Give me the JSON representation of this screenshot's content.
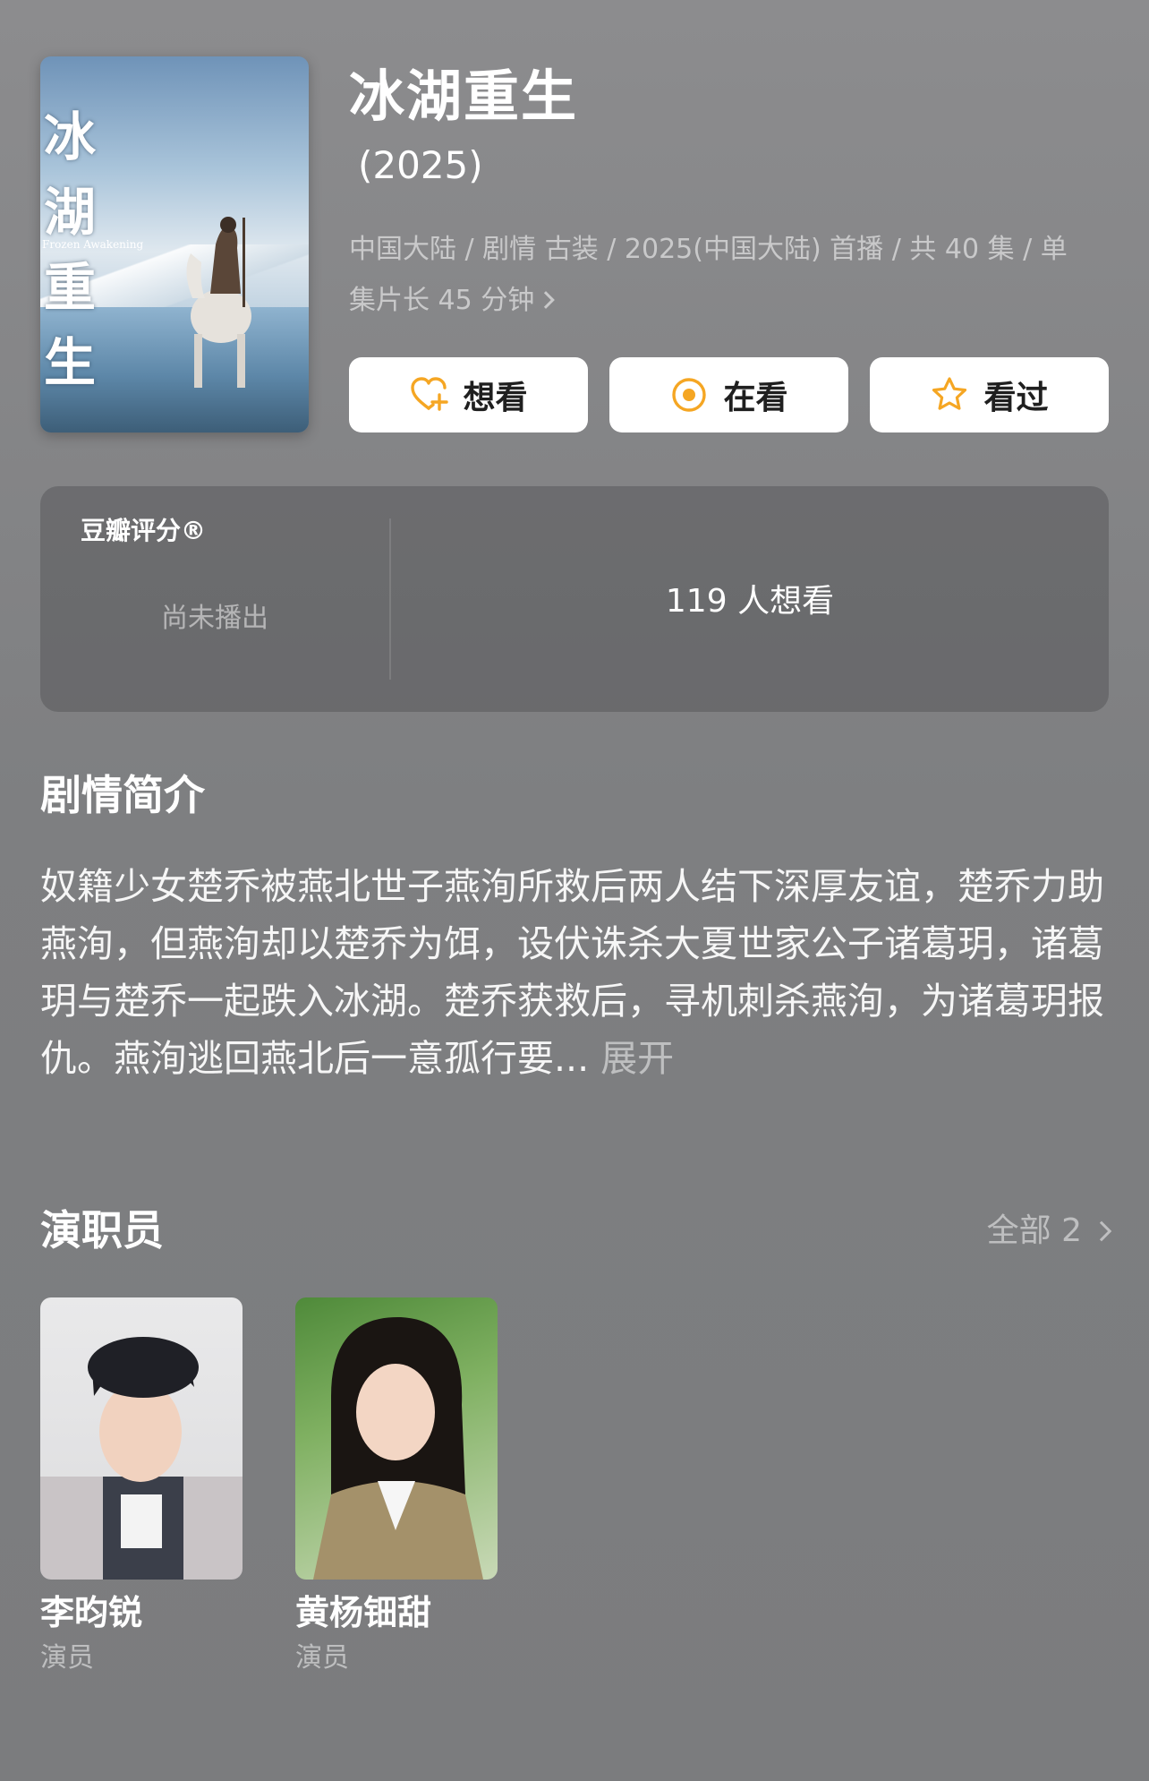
{
  "show": {
    "poster_calligraphy": "冰湖重生",
    "poster_subtitle": "Frozen Awakening",
    "title": "冰湖重生",
    "year": "(2025)",
    "meta_line1": "中国大陆 / 剧情 古装 / 2025(中国大陆) 首播 / 共 40 集 / 单",
    "meta_line2": "集片长 45 分钟"
  },
  "actions": {
    "want": "想看",
    "doing": "在看",
    "done": "看过"
  },
  "rating": {
    "label": "豆瓣评分®",
    "status": "尚未播出",
    "wish_count": "119 人想看"
  },
  "synopsis": {
    "heading": "剧情简介",
    "text": "奴籍少女楚乔被燕北世子燕洵所救后两人结下深厚友谊，楚乔力助燕洵，但燕洵却以楚乔为饵，设伏诛杀大夏世家公子诸葛玥，诸葛玥与楚乔一起跌入冰湖。楚乔获救后，寻机刺杀燕洵，为诸葛玥报仇。燕洵逃回燕北后一意孤行要...",
    "expand": "展开"
  },
  "cast": {
    "heading": "演职员",
    "all_label": "全部 2",
    "members": [
      {
        "name": "李昀锐",
        "role": "演员"
      },
      {
        "name": "黄杨钿甜",
        "role": "演员"
      }
    ]
  },
  "colors": {
    "accent_orange": "#f5a623",
    "button_bg": "#ffffff"
  },
  "icons": {
    "want": "heart-plus-icon",
    "doing": "target-circle-icon",
    "done": "star-outline-icon"
  }
}
